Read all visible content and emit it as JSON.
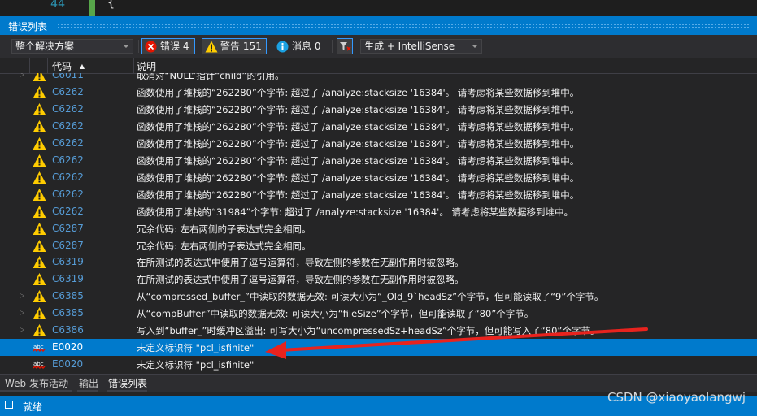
{
  "editor": {
    "line_number": "44",
    "code": "{"
  },
  "panel": {
    "title": "错误列表"
  },
  "toolbar": {
    "scope": "整个解决方案",
    "errors_label": "错误 4",
    "warnings_label": "警告 151",
    "messages_label": "消息 0",
    "build_filter": "生成 + IntelliSense"
  },
  "columns": {
    "code": "代码",
    "desc": "说明"
  },
  "rows": [
    {
      "type": "warning",
      "code": "C6011",
      "desc": "取消对“NULL”指针“child”的引用。",
      "expand": true
    },
    {
      "type": "warning",
      "code": "C6262",
      "desc": "函数使用了堆栈的“262280”个字节: 超过了 /analyze:stacksize '16384'。 请考虑将某些数据移到堆中。"
    },
    {
      "type": "warning",
      "code": "C6262",
      "desc": "函数使用了堆栈的“262280”个字节: 超过了 /analyze:stacksize '16384'。 请考虑将某些数据移到堆中。"
    },
    {
      "type": "warning",
      "code": "C6262",
      "desc": "函数使用了堆栈的“262280”个字节: 超过了 /analyze:stacksize '16384'。 请考虑将某些数据移到堆中。"
    },
    {
      "type": "warning",
      "code": "C6262",
      "desc": "函数使用了堆栈的“262280”个字节: 超过了 /analyze:stacksize '16384'。 请考虑将某些数据移到堆中。"
    },
    {
      "type": "warning",
      "code": "C6262",
      "desc": "函数使用了堆栈的“262280”个字节: 超过了 /analyze:stacksize '16384'。 请考虑将某些数据移到堆中。"
    },
    {
      "type": "warning",
      "code": "C6262",
      "desc": "函数使用了堆栈的“262280”个字节: 超过了 /analyze:stacksize '16384'。 请考虑将某些数据移到堆中。"
    },
    {
      "type": "warning",
      "code": "C6262",
      "desc": "函数使用了堆栈的“262280”个字节: 超过了 /analyze:stacksize '16384'。 请考虑将某些数据移到堆中。"
    },
    {
      "type": "warning",
      "code": "C6262",
      "desc": "函数使用了堆栈的“31984”个字节: 超过了 /analyze:stacksize '16384'。 请考虑将某些数据移到堆中。"
    },
    {
      "type": "warning",
      "code": "C6287",
      "desc": "冗余代码: 左右两侧的子表达式完全相同。"
    },
    {
      "type": "warning",
      "code": "C6287",
      "desc": "冗余代码: 左右两侧的子表达式完全相同。"
    },
    {
      "type": "warning",
      "code": "C6319",
      "desc": "在所测试的表达式中使用了逗号运算符，导致左侧的参数在无副作用时被忽略。"
    },
    {
      "type": "warning",
      "code": "C6319",
      "desc": "在所测试的表达式中使用了逗号运算符，导致左侧的参数在无副作用时被忽略。"
    },
    {
      "type": "warning",
      "code": "C6385",
      "desc": "从“compressed_buffer_”中读取的数据无效: 可读大小为“_Old_9`headSz”个字节，但可能读取了“9”个字节。",
      "expand": true
    },
    {
      "type": "warning",
      "code": "C6385",
      "desc": "从“compBuffer”中读取的数据无效: 可读大小为“fileSize”个字节，但可能读取了“80”个字节。",
      "expand": true
    },
    {
      "type": "warning",
      "code": "C6386",
      "desc": "写入到“buffer_”时缓冲区溢出: 可写大小为“uncompressedSz+headSz”个字节，但可能写入了“80”个字节。",
      "expand": true
    },
    {
      "type": "error",
      "code": "E0020",
      "desc": "未定义标识符 \"pcl_isfinite\"",
      "selected": true
    },
    {
      "type": "error",
      "code": "E0020",
      "desc": "未定义标识符 \"pcl_isfinite\""
    }
  ],
  "tabs": [
    "Web 发布活动",
    "输出",
    "错误列表"
  ],
  "status": {
    "text": "就绪"
  },
  "watermark": "CSDN @xiaoyaolangwj",
  "colors": {
    "accent": "#007acc",
    "warning": "#ffcc00",
    "error": "#e51400",
    "code_link": "#569cd6",
    "arrow": "#e8231e"
  }
}
